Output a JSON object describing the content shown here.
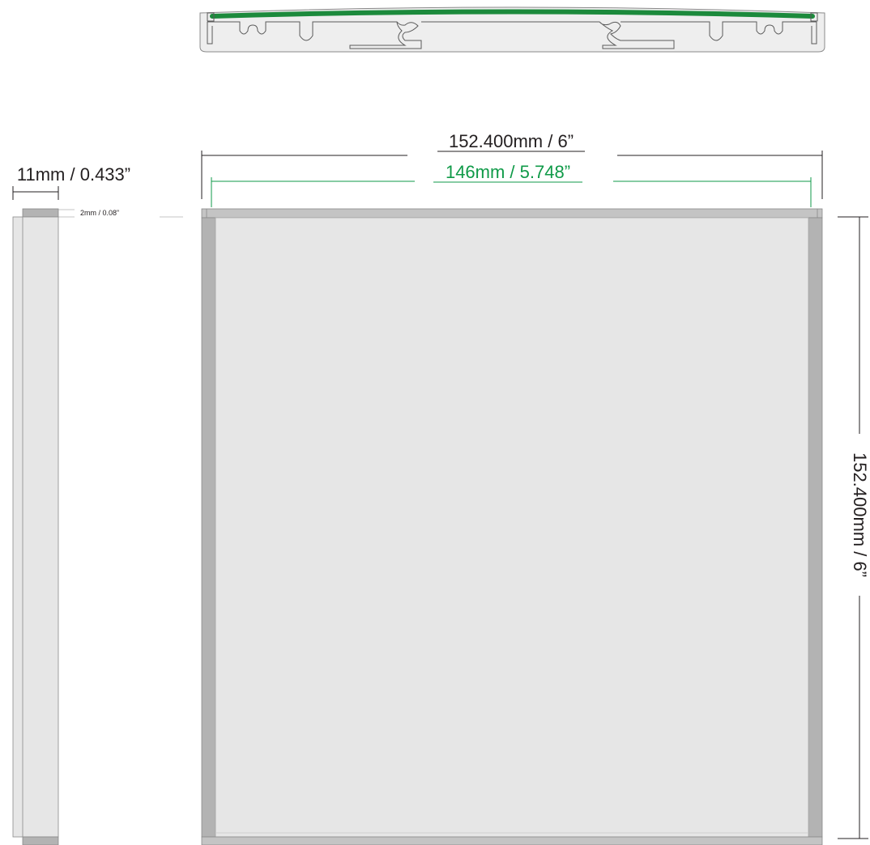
{
  "colors": {
    "profile_fill": "#eeeeee",
    "profile_stroke": "#5a5a5a",
    "led_strip": "#1c8a3c",
    "panel_face": "#e6e6e6",
    "panel_edge": "#b3b3b3",
    "dimension_line": "#231f20",
    "dimension_green": "#0f9a48",
    "background": "#ffffff"
  },
  "dimensions": {
    "outer_width": "152.400mm / 6”",
    "inner_width": "146mm / 5.748”",
    "side_depth": "11mm / 0.433”",
    "lip_thickness": "2mm / 0.08”",
    "outer_height": "152.400mm / 6”"
  }
}
